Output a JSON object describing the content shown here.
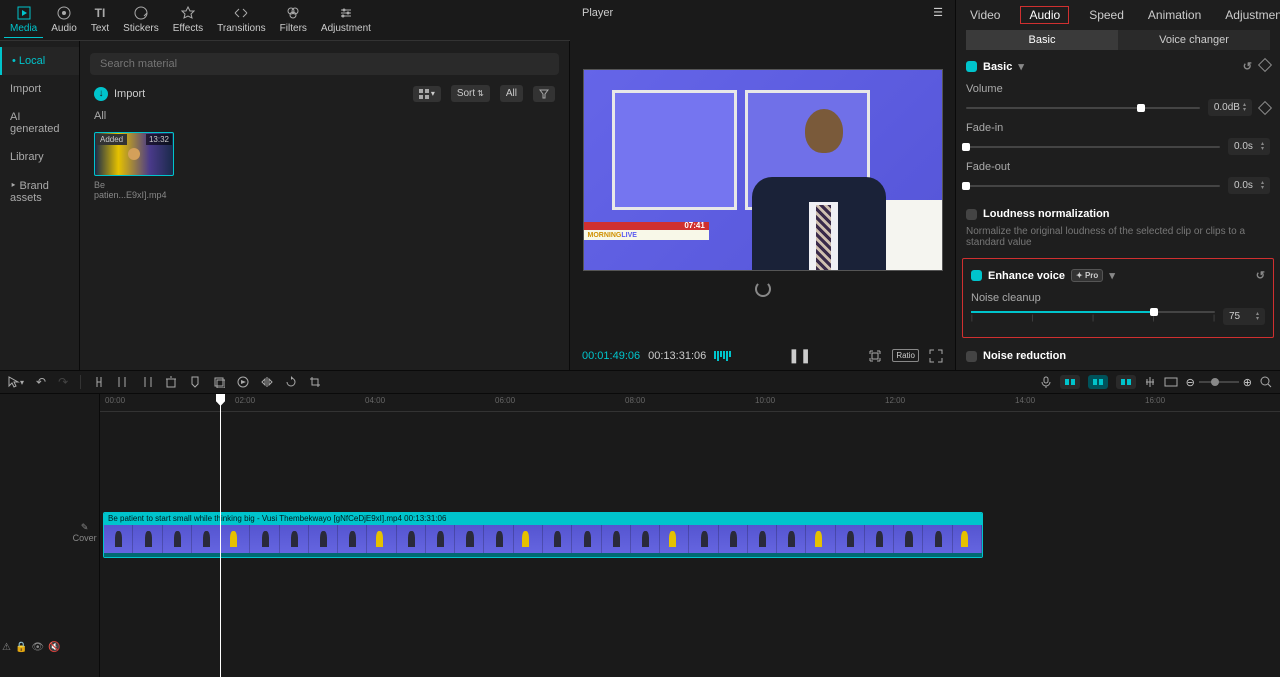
{
  "top_tabs": {
    "media": "Media",
    "audio": "Audio",
    "text": "Text",
    "stickers": "Stickers",
    "effects": "Effects",
    "transitions": "Transitions",
    "filters": "Filters",
    "adjustment": "Adjustment"
  },
  "side_nav": {
    "local": "• Local",
    "import": "Import",
    "ai_generated": "AI generated",
    "library": "Library",
    "brand_assets": "‣ Brand assets"
  },
  "media": {
    "search_placeholder": "Search material",
    "import_label": "Import",
    "sort_label": "Sort",
    "all_btn": "All",
    "all_label": "All",
    "thumb_added": "Added",
    "thumb_duration": "13:32",
    "thumb_name": "Be patien...E9xI].mp4"
  },
  "player": {
    "title": "Player",
    "banner_time": "07:41",
    "banner_text_1": "MORNING",
    "banner_text_2": "LIVE",
    "time_current": "00:01:49:06",
    "time_total": "00:13:31:06",
    "ratio": "Ratio"
  },
  "props": {
    "tabs": {
      "video": "Video",
      "audio": "Audio",
      "speed": "Speed",
      "animation": "Animation",
      "adjustment": "Adjustment"
    },
    "subtabs": {
      "basic": "Basic",
      "voice_changer": "Voice changer"
    },
    "basic": {
      "header": "Basic",
      "volume_label": "Volume",
      "volume_value": "0.0dB",
      "fadein_label": "Fade-in",
      "fadein_value": "0.0s",
      "fadeout_label": "Fade-out",
      "fadeout_value": "0.0s"
    },
    "loudness": {
      "header": "Loudness normalization",
      "desc": "Normalize the original loudness of the selected clip or clips to a standard value"
    },
    "enhance": {
      "header": "Enhance voice",
      "pro": "✦ Pro",
      "noise_label": "Noise cleanup",
      "noise_value": "75"
    },
    "noise_reduction": {
      "header": "Noise reduction"
    }
  },
  "timeline": {
    "cover": "Cover",
    "ruler": [
      "00:00",
      "02:00",
      "04:00",
      "06:00",
      "08:00",
      "10:00",
      "12:00",
      "14:00",
      "16:00"
    ],
    "clip_label": "Be patient to start small while thinking big - Vusi Thembekwayo [gNfCeDjE9xI].mp4   00:13:31:06"
  }
}
